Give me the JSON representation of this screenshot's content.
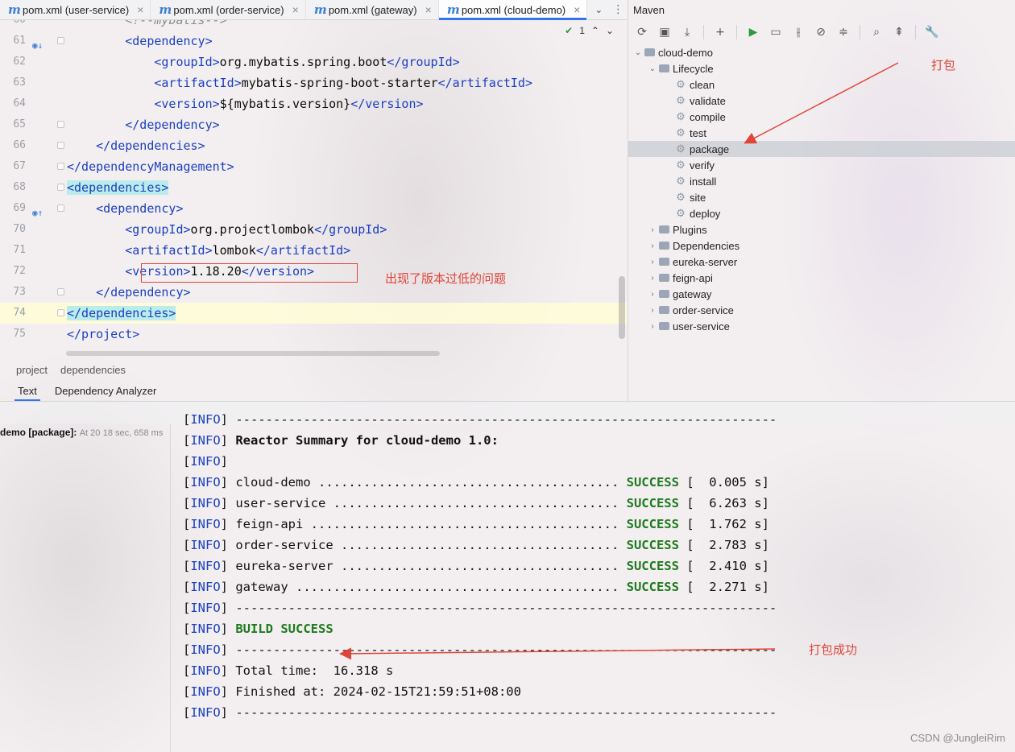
{
  "tabs": [
    {
      "label": "pom.xml (user-service)",
      "active": false
    },
    {
      "label": "pom.xml (order-service)",
      "active": false
    },
    {
      "label": "pom.xml (gateway)",
      "active": false
    },
    {
      "label": "pom.xml (cloud-demo)",
      "active": true
    }
  ],
  "tab_icon_letter": "m",
  "inspection": {
    "count": "1"
  },
  "editor": {
    "lines": [
      {
        "num": "60",
        "indent": "        ",
        "parts": [
          {
            "t": "<!--mybatis-->",
            "c": "comment"
          }
        ]
      },
      {
        "num": "61",
        "indent": "        ",
        "parts": [
          {
            "t": "<dependency>",
            "c": "tag"
          }
        ]
      },
      {
        "num": "62",
        "indent": "            ",
        "parts": [
          {
            "t": "<groupId>",
            "c": "tag"
          },
          {
            "t": "org.mybatis.spring.boot",
            "c": ""
          },
          {
            "t": "</groupId>",
            "c": "tag"
          }
        ]
      },
      {
        "num": "63",
        "indent": "            ",
        "parts": [
          {
            "t": "<artifactId>",
            "c": "tag"
          },
          {
            "t": "mybatis-spring-boot-starter",
            "c": ""
          },
          {
            "t": "</artifactId>",
            "c": "tag"
          }
        ]
      },
      {
        "num": "64",
        "indent": "            ",
        "parts": [
          {
            "t": "<version>",
            "c": "tag"
          },
          {
            "t": "${mybatis.version}",
            "c": ""
          },
          {
            "t": "</version>",
            "c": "tag"
          }
        ]
      },
      {
        "num": "65",
        "indent": "        ",
        "parts": [
          {
            "t": "</dependency>",
            "c": "tag"
          }
        ]
      },
      {
        "num": "66",
        "indent": "    ",
        "parts": [
          {
            "t": "</dependencies>",
            "c": "tag"
          }
        ]
      },
      {
        "num": "67",
        "indent": "",
        "parts": [
          {
            "t": "</dependencyManagement>",
            "c": "tag"
          }
        ]
      },
      {
        "num": "68",
        "indent": "",
        "parts": [
          {
            "t": "<dependencies>",
            "c": "tag-hl"
          }
        ]
      },
      {
        "num": "69",
        "indent": "    ",
        "parts": [
          {
            "t": "<dependency>",
            "c": "tag"
          }
        ]
      },
      {
        "num": "70",
        "indent": "        ",
        "parts": [
          {
            "t": "<groupId>",
            "c": "tag"
          },
          {
            "t": "org.projectlombok",
            "c": ""
          },
          {
            "t": "</groupId>",
            "c": "tag"
          }
        ]
      },
      {
        "num": "71",
        "indent": "        ",
        "parts": [
          {
            "t": "<artifactId>",
            "c": "tag"
          },
          {
            "t": "lombok",
            "c": ""
          },
          {
            "t": "</artifactId>",
            "c": "tag"
          }
        ]
      },
      {
        "num": "72",
        "indent": "        ",
        "parts": [
          {
            "t": "<version>",
            "c": "tag"
          },
          {
            "t": "1.18.20",
            "c": ""
          },
          {
            "t": "</version>",
            "c": "tag"
          }
        ]
      },
      {
        "num": "73",
        "indent": "    ",
        "parts": [
          {
            "t": "</dependency>",
            "c": "tag"
          }
        ]
      },
      {
        "num": "74",
        "indent": "",
        "parts": [
          {
            "t": "</dependencies>",
            "c": "tag-hl"
          }
        ]
      },
      {
        "num": "75",
        "indent": "",
        "parts": [
          {
            "t": "</project>",
            "c": "tag"
          }
        ]
      }
    ],
    "annotation": "出现了版本过低的问题"
  },
  "breadcrumb": [
    "project",
    "dependencies"
  ],
  "subtabs": [
    "Text",
    "Dependency Analyzer"
  ],
  "maven": {
    "title": "Maven",
    "root": "cloud-demo",
    "lifecycle_label": "Lifecycle",
    "lifecycle": [
      "clean",
      "validate",
      "compile",
      "test",
      "package",
      "verify",
      "install",
      "site",
      "deploy"
    ],
    "selected": "package",
    "groups": [
      "Plugins",
      "Dependencies"
    ],
    "modules": [
      "eureka-server",
      "feign-api",
      "gateway",
      "order-service",
      "user-service"
    ],
    "annotation": "打包"
  },
  "run": {
    "task_label": "demo [package]:",
    "task_time": "At 20",
    "duration": "18 sec, 658 ms"
  },
  "console": {
    "tag": "INFO",
    "separator": "------------------------------------------------------------------------",
    "summary_title": "Reactor Summary for cloud-demo 1.0:",
    "modules": [
      {
        "name": "cloud-demo",
        "dots": " ........................................",
        "status": "SUCCESS",
        "time": "[  0.005 s]"
      },
      {
        "name": "user-service",
        "dots": " ......................................",
        "status": "SUCCESS",
        "time": "[  6.263 s]"
      },
      {
        "name": "feign-api",
        "dots": " .........................................",
        "status": "SUCCESS",
        "time": "[  1.762 s]"
      },
      {
        "name": "order-service",
        "dots": " .....................................",
        "status": "SUCCESS",
        "time": "[  2.783 s]"
      },
      {
        "name": "eureka-server",
        "dots": " .....................................",
        "status": "SUCCESS",
        "time": "[  2.410 s]"
      },
      {
        "name": "gateway",
        "dots": " ...........................................",
        "status": "SUCCESS",
        "time": "[  2.271 s]"
      }
    ],
    "build_result": "BUILD SUCCESS",
    "total_time": "Total time:  16.318 s",
    "finished_at": "Finished at: 2024-02-15T21:59:51+08:00",
    "annotation": "打包成功"
  },
  "watermark": "CSDN @JungleiRim",
  "colors": {
    "annotation": "#e0453a",
    "accent": "#3574f0",
    "tag": "#1a3fc2",
    "success": "#1f7a1f"
  }
}
